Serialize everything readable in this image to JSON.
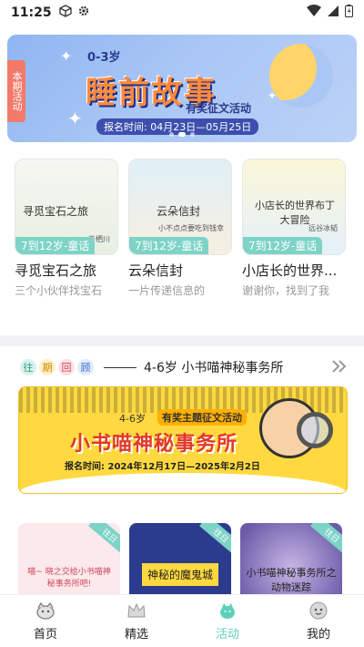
{
  "status": {
    "time": "11:25"
  },
  "hero": {
    "side_tag": "本期活动",
    "age": "0-3岁",
    "title": "睡前故事",
    "subtitle": "有奖征文活动",
    "date": "报名时间: 04月23日—05月25日"
  },
  "books": [
    {
      "cover_title": "寻觅宝石之旅",
      "cover_note": "于栖川",
      "tag": "7到12岁-童话",
      "name": "寻觅宝石之旅",
      "desc": "三个小伙伴找宝石",
      "bg": "#eef3e9"
    },
    {
      "cover_title": "云朵信封",
      "cover_note": "小不点点要吃到钱幸",
      "tag": "7到12岁-童话",
      "name": "云朵信封",
      "desc": "一片传递信息的",
      "bg": "#f6f1e4"
    },
    {
      "cover_title": "小店长的世界布丁大冒险",
      "cover_note": "远谷冰韬",
      "tag": "7到12岁-童话",
      "name": "小店长的世界...",
      "desc": "谢谢你，找到了我",
      "bg": "#eaf4fb"
    }
  ],
  "review": {
    "chips": [
      "往",
      "期",
      "回",
      "顾"
    ],
    "title": "4-6岁 小书喵神秘事务所",
    "poster": {
      "age": "4-6岁",
      "tag": "有奖主题征文活动",
      "title": "小书喵神秘事务所",
      "date": "报名时间: 2024年12月17日—2025年2月2日"
    },
    "minis": [
      {
        "title": "喵~\n晓之交给小书喵神秘事务所吧!",
        "ribbon": "往日",
        "bg": "#fbe9ec"
      },
      {
        "title": "神秘的魔鬼城",
        "ribbon": "往日",
        "bg": "#2b3b8e"
      },
      {
        "title": "小书喵神秘事务所之动物迷踪",
        "ribbon": "往日",
        "bg": "#6b5ba8"
      }
    ]
  },
  "nav": [
    {
      "label": "首页",
      "icon": "home-icon"
    },
    {
      "label": "精选",
      "icon": "crown-icon"
    },
    {
      "label": "活动",
      "icon": "activity-icon"
    },
    {
      "label": "我的",
      "icon": "profile-icon"
    }
  ],
  "colors": {
    "accent": "#5fd0b9",
    "tag": "#7ed3c7"
  }
}
